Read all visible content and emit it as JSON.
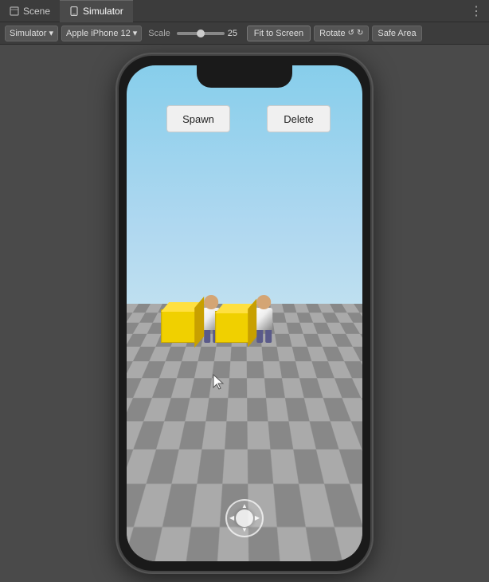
{
  "tabs": [
    {
      "id": "scene",
      "label": "Scene",
      "icon": "scene-icon",
      "active": false
    },
    {
      "id": "simulator",
      "label": "Simulator",
      "icon": "simulator-icon",
      "active": true
    }
  ],
  "toolbar": {
    "simulator_label": "Simulator",
    "device_label": "Apple iPhone 12",
    "scale_label": "Scale",
    "scale_value": "25",
    "fit_to_screen": "Fit to Screen",
    "rotate_label": "Rotate",
    "safe_area_label": "Safe Area"
  },
  "screen": {
    "spawn_button": "Spawn",
    "delete_button": "Delete"
  },
  "colors": {
    "bg": "#3c3c3c",
    "phone_frame": "#1a1a1a",
    "sky_top": "#87ceeb",
    "ground": "#aaa",
    "cube": "#f0d000",
    "button_bg": "#f0f0f0"
  }
}
